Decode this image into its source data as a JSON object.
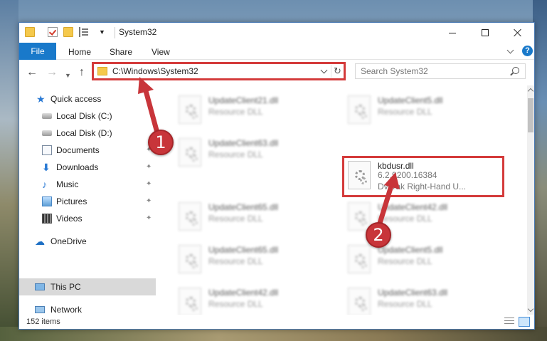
{
  "window": {
    "title": "System32"
  },
  "ribbon": {
    "tabs": [
      {
        "label": "File"
      },
      {
        "label": "Home"
      },
      {
        "label": "Share"
      },
      {
        "label": "View"
      }
    ]
  },
  "nav": {
    "address": "C:\\Windows\\System32",
    "search_placeholder": "Search System32"
  },
  "sidebar": {
    "items": [
      {
        "label": "Quick access",
        "icon": "star-icon"
      },
      {
        "label": "Local Disk (C:)",
        "icon": "disk-icon"
      },
      {
        "label": "Local Disk (D:)",
        "icon": "disk-icon"
      },
      {
        "label": "Documents",
        "icon": "documents-icon",
        "pinned": true
      },
      {
        "label": "Downloads",
        "icon": "downloads-icon",
        "pinned": true
      },
      {
        "label": "Music",
        "icon": "music-icon",
        "pinned": true
      },
      {
        "label": "Pictures",
        "icon": "pictures-icon",
        "pinned": true
      },
      {
        "label": "Videos",
        "icon": "videos-icon",
        "pinned": true
      },
      {
        "label": "OneDrive",
        "icon": "cloud-icon"
      },
      {
        "label": "This PC",
        "icon": "pc-icon",
        "selected": true
      },
      {
        "label": "Network",
        "icon": "network-icon"
      }
    ]
  },
  "files": [
    {
      "name": "UpdateClient21.dll",
      "type": "Resource DLL"
    },
    {
      "name": "UpdateClient5.dll",
      "type": "Resource DLL"
    },
    {
      "name": "UpdateClient63.dll",
      "type": "Resource DLL"
    },
    {
      "name": "kbdusr.dll",
      "version": "6.2.9200.16384",
      "description": "Dvorak Right-Hand U...",
      "highlighted": true
    },
    {
      "name": "UpdateClient65.dll",
      "type": "Resource DLL"
    },
    {
      "name": "UpdateClient42.dll",
      "type": "Resource DLL"
    },
    {
      "name": "UpdateClient65.dll",
      "type": "Resource DLL"
    },
    {
      "name": "UpdateClient5.dll",
      "type": "Resource DLL"
    },
    {
      "name": "UpdateClient42.dll",
      "type": "Resource DLL"
    },
    {
      "name": "UpdateClient63.dll",
      "type": "Resource DLL"
    }
  ],
  "status": {
    "item_count": "152 items"
  },
  "annotations": {
    "step1": "1",
    "step2": "2",
    "highlight_color": "#d43b3b",
    "marker_color": "#c8353a"
  }
}
